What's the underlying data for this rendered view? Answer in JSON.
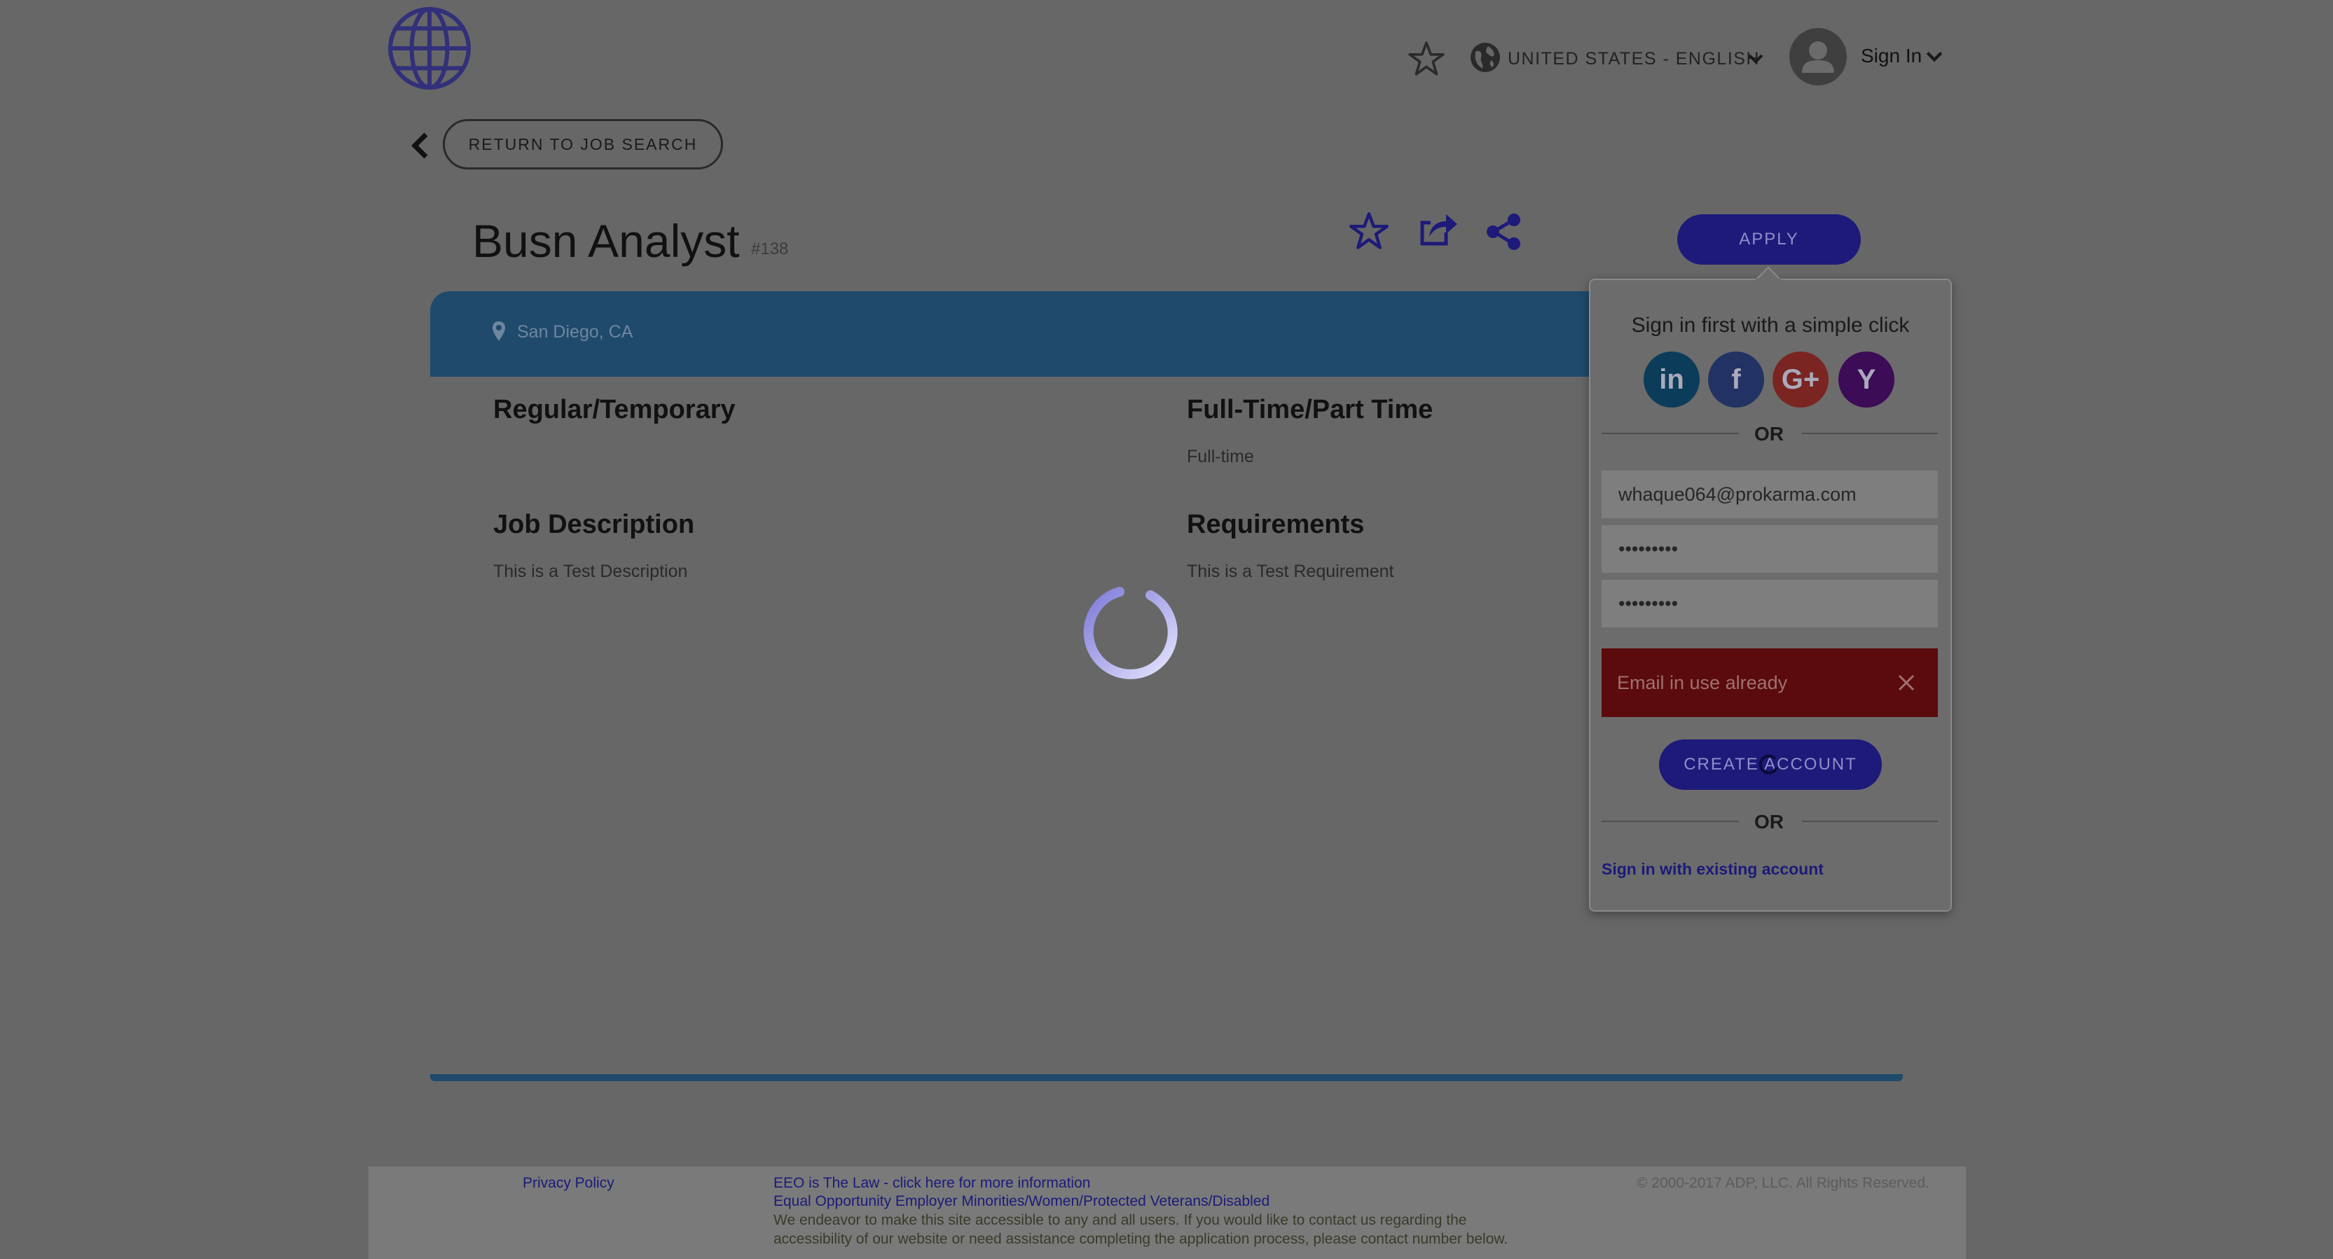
{
  "header": {
    "logo_icon": "globe-logo-icon",
    "favorites_icon": "star-icon",
    "locale_icon": "globe-icon",
    "locale_label": "UNITED STATES - ENGLISH",
    "avatar_icon": "user-icon",
    "signin_label": "Sign In"
  },
  "nav": {
    "return_label": "RETURN TO JOB SEARCH"
  },
  "job": {
    "title": "Busn Analyst",
    "number": "#138",
    "location": "San Diego, CA",
    "sections": {
      "regular_temporary": {
        "heading": "Regular/Temporary",
        "value": ""
      },
      "fulltime_parttime": {
        "heading": "Full-Time/Part Time",
        "value": "Full-time"
      },
      "job_description": {
        "heading": "Job Description",
        "value": "This is a Test Description"
      },
      "requirements": {
        "heading": "Requirements",
        "value": "This is a Test Requirement"
      }
    }
  },
  "apply_label": "APPLY",
  "signin_popup": {
    "title": "Sign in first with a simple click",
    "social": {
      "linkedin": "in",
      "facebook": "f",
      "google": "G+",
      "yahoo": "Y"
    },
    "or_label": "OR",
    "email_value": "whaque064@prokarma.com",
    "password_value": "•••••••••",
    "confirm_password_value": "•••••••••",
    "error_message": "Email in use already",
    "create_account_label": "CREATE ACCOUNT",
    "existing_account_link": "Sign in with existing account"
  },
  "footer": {
    "privacy_policy": "Privacy Policy",
    "eeo_link": "EEO is The Law - click here for more information",
    "eeo_statement": "Equal Opportunity Employer Minorities/Women/Protected Veterans/Disabled",
    "accessibility_line1": "We endeavor to make this site accessible to any and all users. If you would like to contact us regarding the",
    "accessibility_line2": "accessibility of our website or need assistance completing the application process, please contact number below.",
    "copyright": "© 2000-2017 ADP, LLC. All Rights Reserved."
  },
  "colors": {
    "overlay_background": "#676767",
    "brand_blue": "#1f4a6b",
    "button_indigo": "#1d1a7a",
    "error_red": "#5b0b0b",
    "spinner": "#c7c5f2"
  }
}
